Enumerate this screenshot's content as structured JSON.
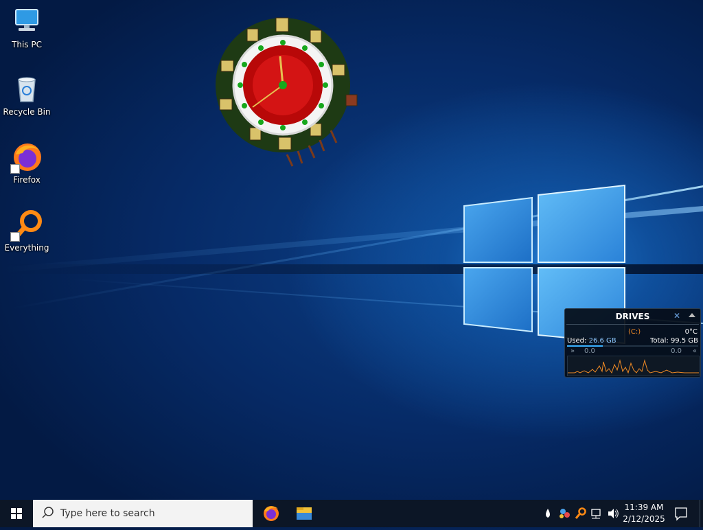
{
  "desktop": {
    "icons": [
      {
        "label": "This PC",
        "icon": "computer-icon"
      },
      {
        "label": "Recycle Bin",
        "icon": "recycle-bin-icon"
      },
      {
        "label": "Firefox",
        "icon": "firefox-icon"
      },
      {
        "label": "Everything",
        "icon": "everything-search-icon"
      }
    ],
    "clock_gadget": {
      "icon": "christmas-clock-icon"
    },
    "drives_gadget": {
      "title": "DRIVES",
      "drive": "(C:)",
      "temperature": "0°C",
      "used_label": "Used:",
      "used_value": "26.6 GB",
      "total_label": "Total:",
      "total_value": "99.5 GB",
      "read_value": "0.0",
      "write_value": "0.0",
      "accent_color": "#f08a24"
    }
  },
  "taskbar": {
    "start_icon": "windows-start-icon",
    "search_placeholder": "Type here to search",
    "apps": [
      {
        "name": "Firefox",
        "icon": "firefox-icon"
      },
      {
        "name": "File Explorer",
        "icon": "file-explorer-icon"
      }
    ],
    "tray_icons": [
      "water-drop-icon",
      "people-network-icon",
      "everything-search-icon",
      "network-icon",
      "volume-icon"
    ],
    "time": "11:39 AM",
    "date": "2/12/2025",
    "notification_icon": "action-center-icon"
  }
}
